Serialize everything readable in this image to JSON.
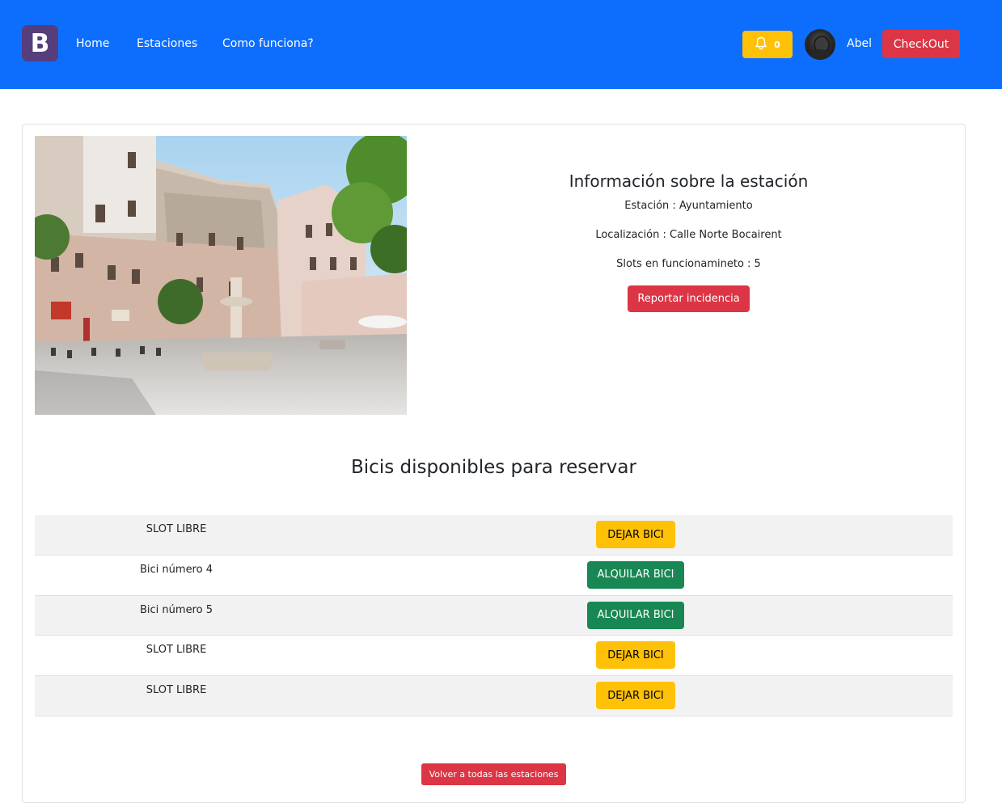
{
  "navbar": {
    "brand": "B",
    "links": [
      {
        "label": "Home"
      },
      {
        "label": "Estaciones"
      },
      {
        "label": "Como funciona?"
      }
    ],
    "notifications": {
      "icon": "bell-icon",
      "count": "0"
    },
    "user": {
      "name": "Abel"
    },
    "checkout_label": "CheckOut"
  },
  "station": {
    "title": "Información sobre la estación",
    "name_line": "Estación : Ayuntamiento",
    "location_line": "Localización : Calle Norte Bocairent",
    "slots_line": "Slots en funcionamineto : 5",
    "report_label": "Reportar incidencia"
  },
  "bikes": {
    "title": "Bicis disponibles para reservar",
    "rows": [
      {
        "label": "SLOT LIBRE",
        "action": "DEJAR BICI"
      },
      {
        "label": "Bici número 4",
        "action": "ALQUILAR BICI"
      },
      {
        "label": "Bici número 5",
        "action": "ALQUILAR BICI"
      },
      {
        "label": "SLOT LIBRE",
        "action": "DEJAR BICI"
      },
      {
        "label": "SLOT LIBRE",
        "action": "DEJAR BICI"
      }
    ]
  },
  "back_label": "Volver a todas las estaciones",
  "colors": {
    "navbar": "#0d6efd",
    "brand": "#563d7c",
    "danger": "#dc3545",
    "warning": "#ffc107",
    "success": "#198754"
  }
}
